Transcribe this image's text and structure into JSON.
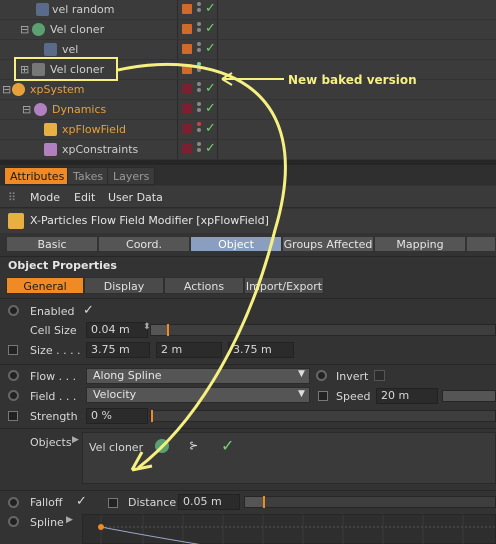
{
  "object_manager": {
    "rows": [
      {
        "name": "vel random",
        "color": "#d06a2a",
        "dot": "#888"
      },
      {
        "name": "Vel cloner",
        "color": "#d06a2a",
        "dot": "#888"
      },
      {
        "name": "vel",
        "color": "#d06a2a",
        "dot": "#888"
      },
      {
        "name": "Vel cloner",
        "color": "#d06a2a",
        "dot": "#6fd6a0"
      },
      {
        "name": "xpSystem",
        "color": "#7a2030",
        "dot": "#888"
      },
      {
        "name": "Dynamics",
        "color": "#7a2030",
        "dot": "#888"
      },
      {
        "name": "xpFlowField",
        "color": "#7a2030",
        "dot": "#d04040"
      },
      {
        "name": "xpConstraints",
        "color": "#7a2030",
        "dot": "#888"
      }
    ]
  },
  "annotation": {
    "text": "New baked version",
    "color": "#f5f080"
  },
  "tabs": [
    "Attributes",
    "Takes",
    "Layers"
  ],
  "menu": [
    "Mode",
    "Edit",
    "User Data"
  ],
  "header": {
    "title": "X-Particles Flow Field Modifier [xpFlowField]"
  },
  "subtabs": [
    "Basic",
    "Coord.",
    "Object",
    "Groups Affected",
    "Mapping"
  ],
  "object_properties": {
    "title": "Object Properties",
    "tabs": [
      "General",
      "Display",
      "Actions",
      "Import/Export"
    ],
    "enabled_label": "Enabled",
    "enabled_check": "✓",
    "cell_size_label": "Cell Size",
    "cell_size_value": "0.04 m",
    "size_label": "Size . . . .",
    "size_x": "3.75 m",
    "size_y": "2 m",
    "size_z": "3.75 m",
    "flow_label": "Flow . . .",
    "flow_value": "Along Spline",
    "invert_label": "Invert",
    "field_label": "Field . . .",
    "field_value": "Velocity",
    "speed_label": "Speed",
    "speed_value": "20 m",
    "strength_label": "Strength",
    "strength_value": "0 %",
    "objects_label": "Objects",
    "objects_item": "Vel cloner",
    "falloff_label": "Falloff",
    "falloff_check": "✓",
    "distance_label": "Distance",
    "distance_value": "0.05 m",
    "spline_label": "Spline"
  }
}
